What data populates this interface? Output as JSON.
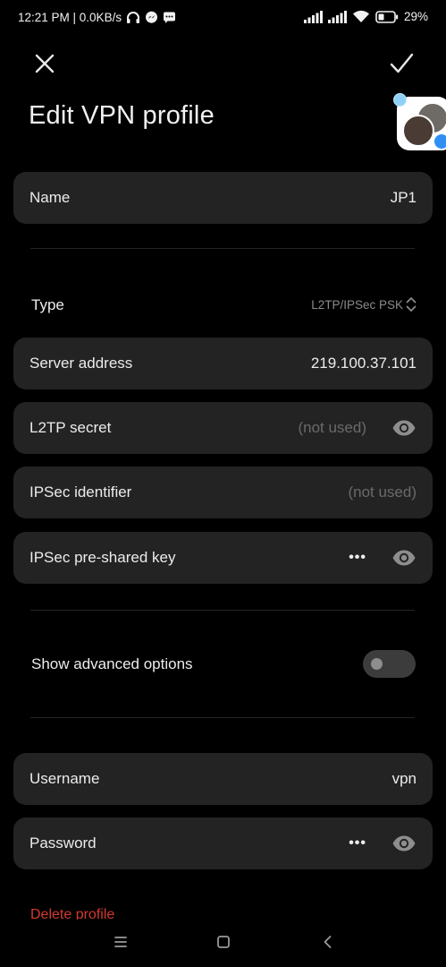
{
  "status_bar": {
    "time_speed": "12:21 PM | 0.0KB/s",
    "battery_percent": "29%",
    "icons": [
      "headphones-icon",
      "messenger-icon",
      "message-icon",
      "signal-icon",
      "signal-icon",
      "wifi-icon",
      "battery-icon"
    ]
  },
  "header": {
    "title": "Edit VPN profile",
    "close_icon": "close-icon",
    "confirm_icon": "check-icon"
  },
  "form": {
    "name": {
      "label": "Name",
      "value": "JP1"
    },
    "type": {
      "label": "Type",
      "value": "L2TP/IPSec PSK"
    },
    "server": {
      "label": "Server address",
      "value": "219.100.37.101"
    },
    "l2tp_secret": {
      "label": "L2TP secret",
      "value": "(not used)"
    },
    "ipsec_identifier": {
      "label": "IPSec identifier",
      "value": "(not used)"
    },
    "ipsec_psk": {
      "label": "IPSec pre-shared key",
      "value": "•••"
    },
    "advanced": {
      "label": "Show advanced options",
      "enabled": false
    },
    "username": {
      "label": "Username",
      "value": "vpn"
    },
    "password": {
      "label": "Password",
      "value": "•••"
    },
    "delete_label": "Delete profile"
  },
  "colors": {
    "background": "#000000",
    "card": "#232323",
    "text": "#ececec",
    "muted": "#6a6a6a",
    "danger": "#d23a2e"
  },
  "nav": {
    "icons": [
      "menu-icon",
      "home-icon",
      "back-icon"
    ]
  }
}
